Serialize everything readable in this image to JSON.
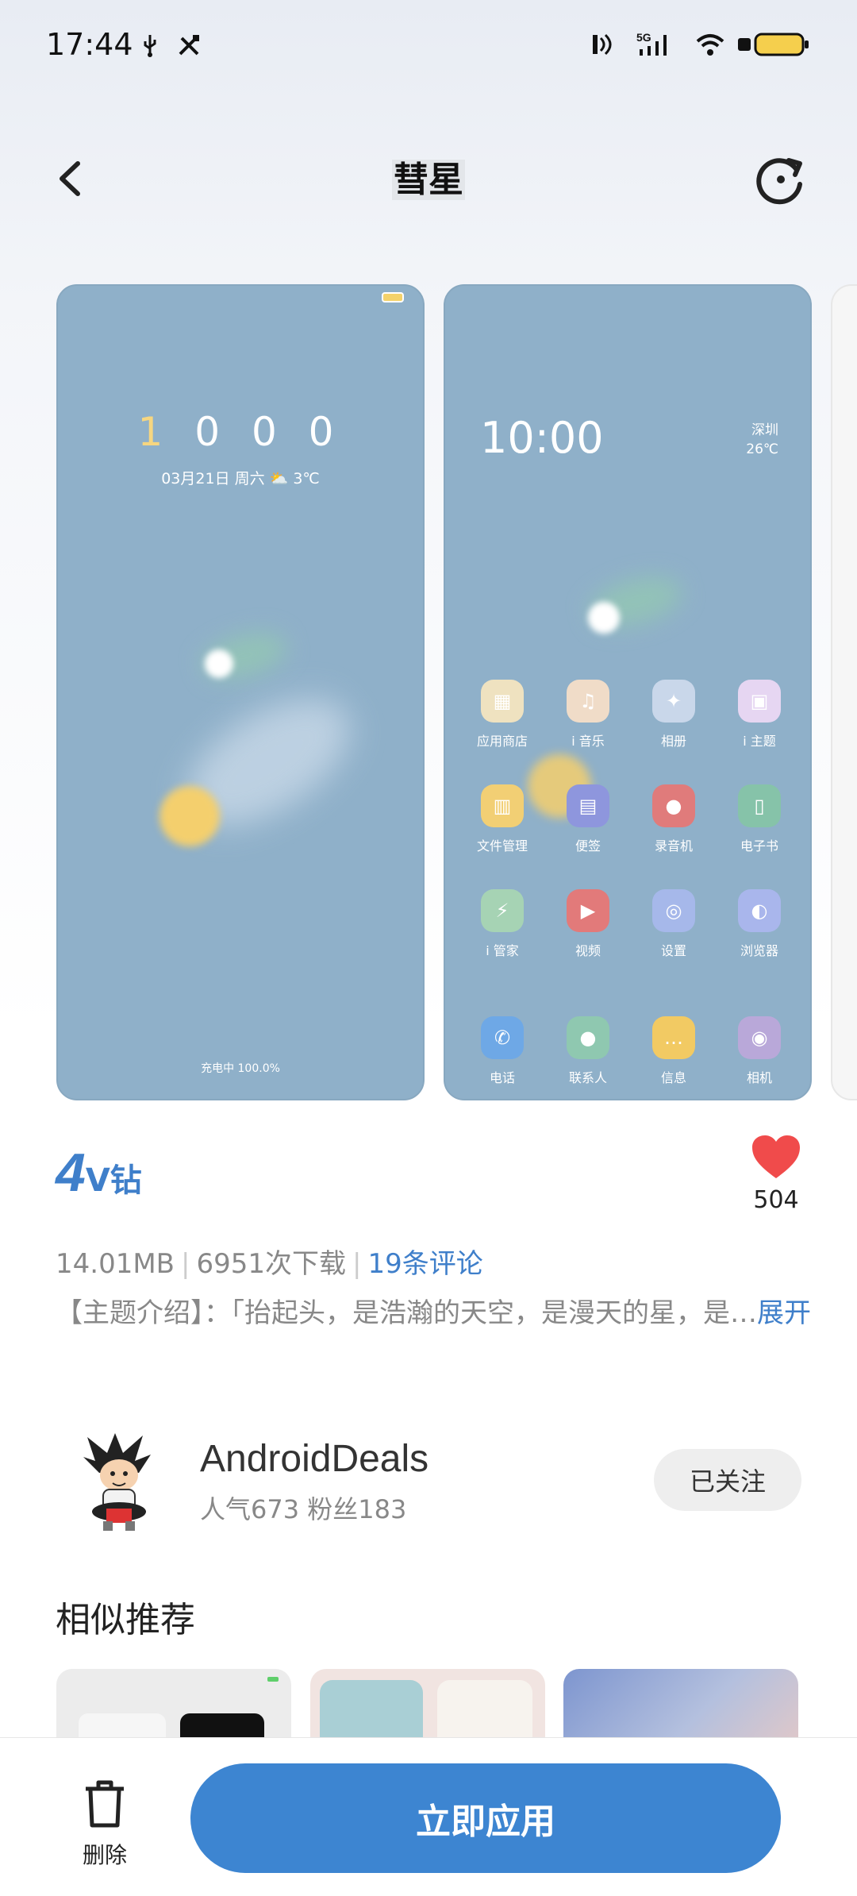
{
  "status_bar": {
    "time": "17:44",
    "left_icons": [
      "usb-icon",
      "tools-icon"
    ],
    "right_icons": [
      "nfc-icon",
      "5g-signal-icon",
      "wifi-icon",
      "battery-icon"
    ],
    "signal_label": "5G"
  },
  "header": {
    "title": "彗星",
    "back_icon": "chevron-left-icon",
    "refresh_icon": "refresh-icon"
  },
  "preview": {
    "lock_screen": {
      "time_first": "1",
      "time_rest": "0 0 0",
      "date_weather": "03月21日  周六 ⛅ 3℃",
      "charging": "充电中 100.0%"
    },
    "home_screen": {
      "time": "10:00",
      "city": "深圳",
      "temperature": "26℃",
      "apps": [
        {
          "label": "应用商店",
          "icon": "app-store-icon",
          "color": "#efe2c0",
          "glyph": "▦"
        },
        {
          "label": "i 音乐",
          "icon": "music-icon",
          "color": "#f0dcc8",
          "glyph": "♫"
        },
        {
          "label": "相册",
          "icon": "album-icon",
          "color": "#c9d7ea",
          "glyph": "✦"
        },
        {
          "label": "i 主题",
          "icon": "theme-icon",
          "color": "#e6d6f2",
          "glyph": "▣"
        },
        {
          "label": "文件管理",
          "icon": "file-manager-icon",
          "color": "#f2cf74",
          "glyph": "▥"
        },
        {
          "label": "便签",
          "icon": "notes-icon",
          "color": "#8e96dd",
          "glyph": "▤"
        },
        {
          "label": "录音机",
          "icon": "recorder-icon",
          "color": "#e07b7b",
          "glyph": "●"
        },
        {
          "label": "电子书",
          "icon": "ebook-icon",
          "color": "#86c3a9",
          "glyph": "▯"
        },
        {
          "label": "i 管家",
          "icon": "manager-icon",
          "color": "#a6d3b4",
          "glyph": "⚡"
        },
        {
          "label": "视频",
          "icon": "video-icon",
          "color": "#e27a7a",
          "glyph": "▶"
        },
        {
          "label": "设置",
          "icon": "settings-icon",
          "color": "#a6b8ea",
          "glyph": "◎"
        },
        {
          "label": "浏览器",
          "icon": "browser-icon",
          "color": "#a9b6ec",
          "glyph": "◐"
        },
        {
          "label": "电话",
          "icon": "phone-icon",
          "color": "#6ea8e6",
          "glyph": "✆"
        },
        {
          "label": "联系人",
          "icon": "contacts-icon",
          "color": "#8fc8b0",
          "glyph": "●"
        },
        {
          "label": "信息",
          "icon": "messages-icon",
          "color": "#f2ca63",
          "glyph": "…"
        },
        {
          "label": "相机",
          "icon": "camera-icon",
          "color": "#b9a8d9",
          "glyph": "◉"
        }
      ]
    }
  },
  "theme": {
    "vip_number": "4",
    "vip_label": "V钻",
    "like_count": "504",
    "size": "14.01MB",
    "downloads": "6951次下载",
    "comments": "19条评论",
    "intro_text": "【主题介绍】：「抬起头，是浩瀚的天空，是漫天的星，是…",
    "expand_label": "展开"
  },
  "author": {
    "name": "AndroidDeals",
    "stats": "人气673 粉丝183",
    "follow_label": "已关注"
  },
  "similar": {
    "title": "相似推荐"
  },
  "bottom": {
    "delete_label": "删除",
    "apply_label": "立即应用"
  },
  "colors": {
    "accent": "#3d85d1",
    "preview_bg": "#8fb0c9",
    "heart": "#f04b4b"
  }
}
